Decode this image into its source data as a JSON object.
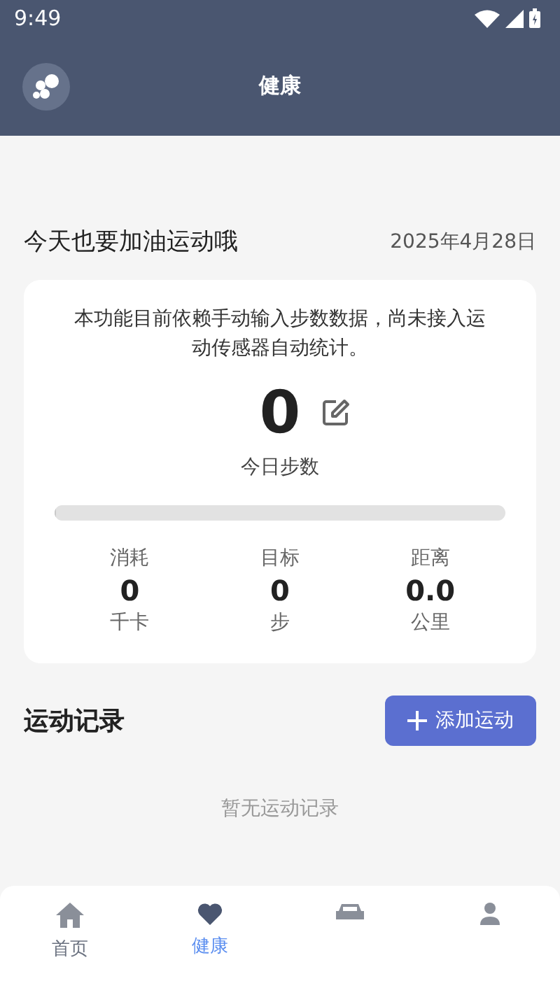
{
  "status_bar": {
    "time": "9:49"
  },
  "header": {
    "title": "健康"
  },
  "greeting": {
    "text": "今天也要加油运动哦",
    "date": "2025年4月28日"
  },
  "steps_card": {
    "notice": "本功能目前依赖手动输入步数数据，尚未接入运动传感器自动统计。",
    "steps": "0",
    "label": "今日步数",
    "level": 0,
    "stats": [
      {
        "label": "消耗",
        "value": "0",
        "unit": "千卡"
      },
      {
        "label": "目标",
        "value": "0",
        "unit": "步"
      },
      {
        "label": "距离",
        "value": "0.0",
        "unit": "公里"
      }
    ]
  },
  "records": {
    "title": "运动记录",
    "add_button": "添加运动",
    "empty": "暂无运动记录"
  },
  "nav": {
    "items": [
      {
        "kind": "home",
        "label": "首页",
        "selected": false
      },
      {
        "kind": "heart",
        "label": "健康",
        "selected": true
      },
      {
        "kind": "car",
        "selected": false
      },
      {
        "kind": "person",
        "selected": false
      }
    ]
  }
}
